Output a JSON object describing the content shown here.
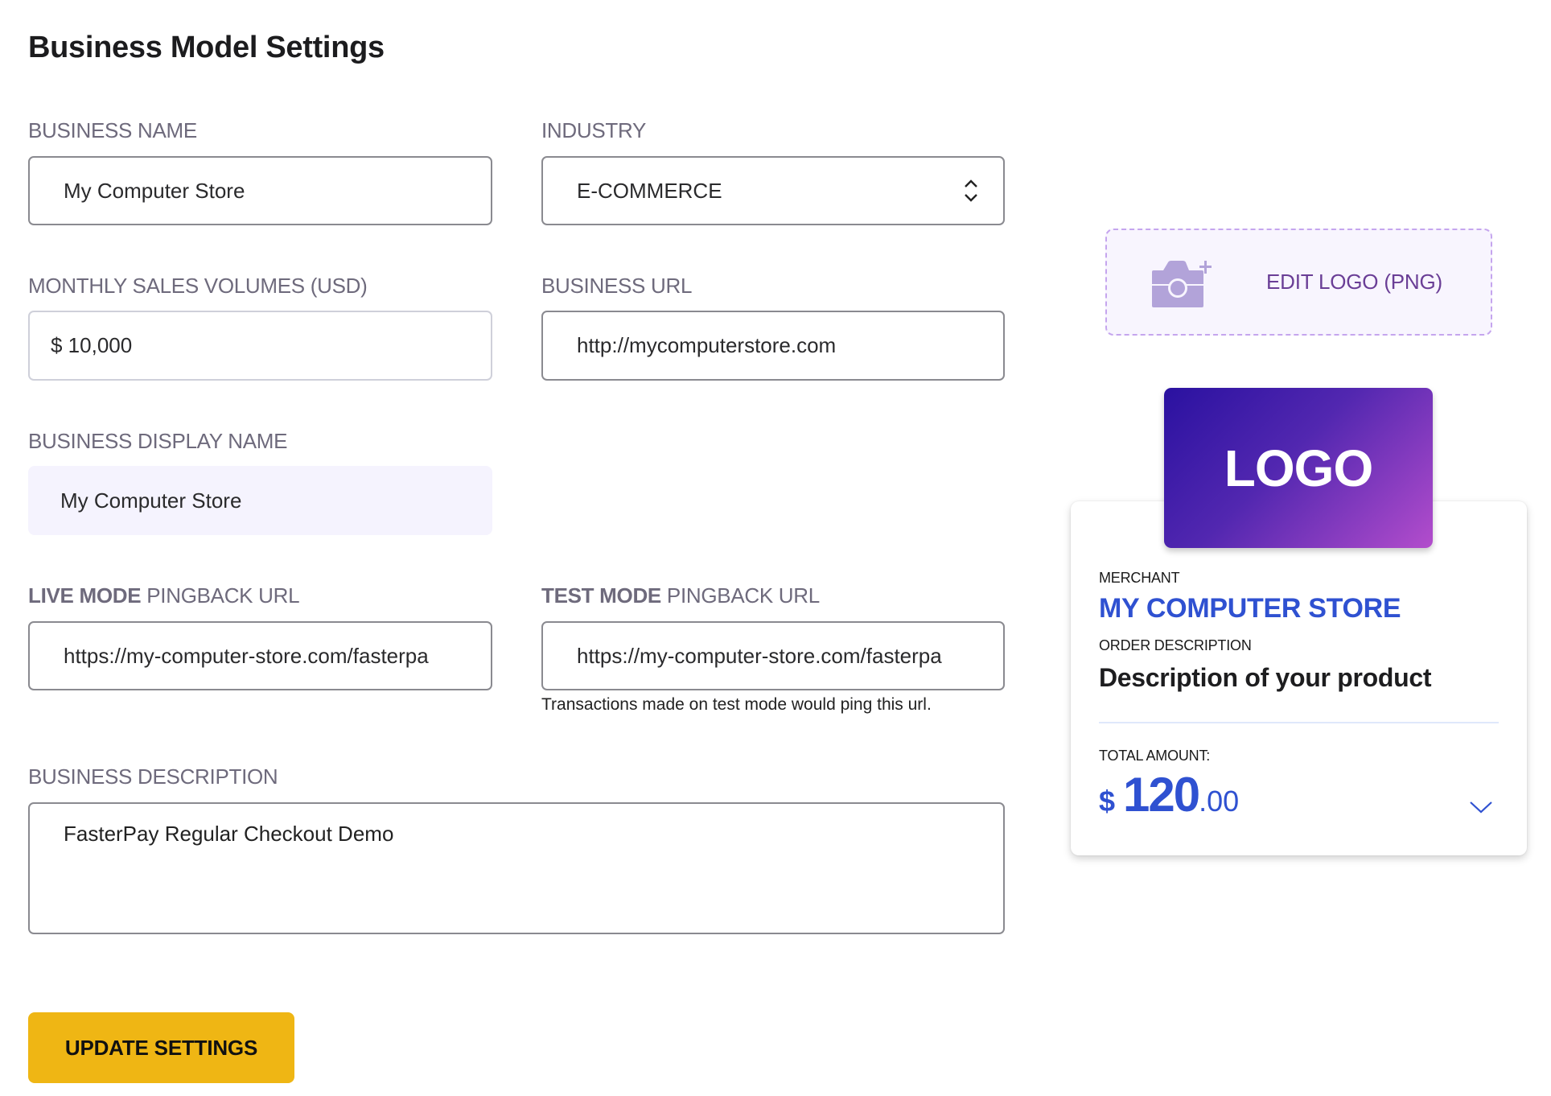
{
  "page": {
    "title": "Business Model Settings"
  },
  "form": {
    "business_name": {
      "label": "BUSINESS NAME",
      "value": "My Computer Store"
    },
    "industry": {
      "label": "INDUSTRY",
      "value": "E-COMMERCE"
    },
    "monthly_sales": {
      "label": "MONTHLY SALES VOLUMES (USD)",
      "value": "$ 10,000"
    },
    "business_url": {
      "label": "BUSINESS URL",
      "value": "http://mycomputerstore.com"
    },
    "display_name": {
      "label": "BUSINESS DISPLAY NAME",
      "value": "My Computer Store"
    },
    "live_pingback": {
      "label_bold": "LIVE MODE",
      "label_rest": " PINGBACK URL",
      "value": "https://my-computer-store.com/fasterpa"
    },
    "test_pingback": {
      "label_bold": "TEST MODE",
      "label_rest": " PINGBACK URL",
      "value": "https://my-computer-store.com/fasterpa",
      "helper": "Transactions made on test mode would ping this url."
    },
    "description": {
      "label": "BUSINESS DESCRIPTION",
      "value": "FasterPay Regular Checkout Demo"
    },
    "submit_label": "UPDATE SETTINGS"
  },
  "logo_panel": {
    "edit_label": "EDIT LOGO (PNG)",
    "logo_text": "LOGO"
  },
  "preview_card": {
    "merchant_label": "MERCHANT",
    "merchant_name": "MY COMPUTER STORE",
    "order_desc_label": "ORDER DESCRIPTION",
    "order_desc": "Description of your product",
    "total_label": "TOTAL AMOUNT:",
    "currency_symbol": "$",
    "amount_int": "120",
    "amount_dec": ".00"
  },
  "colors": {
    "accent_button": "#efb614",
    "brand_blue": "#2f51d1",
    "label_gray": "#6e6a7c",
    "logo_purple": "#6a3e96"
  }
}
